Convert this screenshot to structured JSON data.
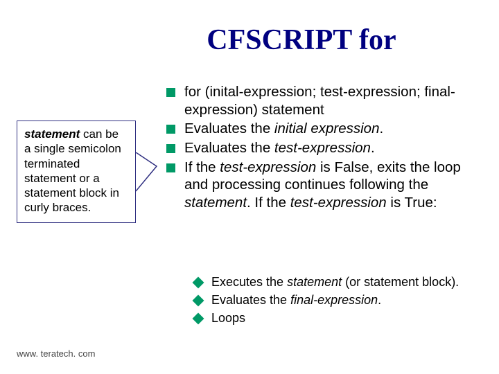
{
  "title": "CFSCRIPT for",
  "callout": {
    "lead": "statement",
    "rest": " can be a single semicolon terminated statement or a statement block in curly braces."
  },
  "bullets": [
    {
      "parts": [
        {
          "t": "for (inital-expression; test-expression; final-expression) statement",
          "i": false
        }
      ]
    },
    {
      "parts": [
        {
          "t": "Evaluates the ",
          "i": false
        },
        {
          "t": "initial expression",
          "i": true
        },
        {
          "t": ".",
          "i": false
        }
      ]
    },
    {
      "parts": [
        {
          "t": "Evaluates the ",
          "i": false
        },
        {
          "t": "test-expression",
          "i": true
        },
        {
          "t": ".",
          "i": false
        }
      ]
    },
    {
      "parts": [
        {
          "t": "If the ",
          "i": false
        },
        {
          "t": "test-expression",
          "i": true
        },
        {
          "t": " is False, exits the loop and processing continues following the ",
          "i": false
        },
        {
          "t": "statement",
          "i": true
        },
        {
          "t": ". If the ",
          "i": false
        },
        {
          "t": "test-expression",
          "i": true
        },
        {
          "t": " is True:",
          "i": false
        }
      ]
    }
  ],
  "sub_bullets": [
    {
      "parts": [
        {
          "t": "Executes the ",
          "i": false
        },
        {
          "t": "statement",
          "i": true
        },
        {
          "t": " (or statement block).",
          "i": false
        }
      ]
    },
    {
      "parts": [
        {
          "t": "Evaluates the ",
          "i": false
        },
        {
          "t": "final-expression",
          "i": true
        },
        {
          "t": ".",
          "i": false
        }
      ]
    },
    {
      "parts": [
        {
          "t": "Loops",
          "i": false
        }
      ]
    }
  ],
  "footer": "www. teratech. com"
}
